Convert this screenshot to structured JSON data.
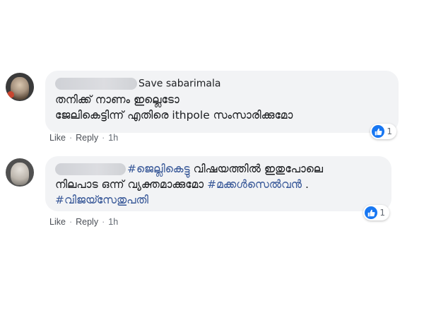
{
  "comments": [
    {
      "author_name": "Save sabarimala",
      "lines": [
        "തനിക്ക് നാണം ഇല്ലെടോ",
        "ജേലികെട്ടിന്ന് എതിരെ ithpole സംസാരിക്കുമോ"
      ],
      "reaction_count": "1",
      "like_label": "Like",
      "reply_label": "Reply",
      "time": "1h"
    },
    {
      "author_name": "",
      "line1_hashtag": "#ജെല്ലികെട്ടു",
      "line1_text": " വിഷയത്തിൽ ഇതുപോലെ",
      "line2_text": "നിലപാട ഒന്ന് വ്യക്തമാക്കുമോ ",
      "line2_hashtag": "#മക്കൾസെൽവൻ",
      "line2_tail": " .",
      "line3_hashtag": "#വിജയ്സേതുപതി",
      "reaction_count": "1",
      "like_label": "Like",
      "reply_label": "Reply",
      "time": "1h"
    }
  ],
  "icons": {
    "reaction": "like-thumbs-up-icon"
  },
  "colors": {
    "bubble": "#f2f3f5",
    "hashtag": "#385898",
    "like_blue": "#1877f2",
    "meta_text": "#606770"
  }
}
